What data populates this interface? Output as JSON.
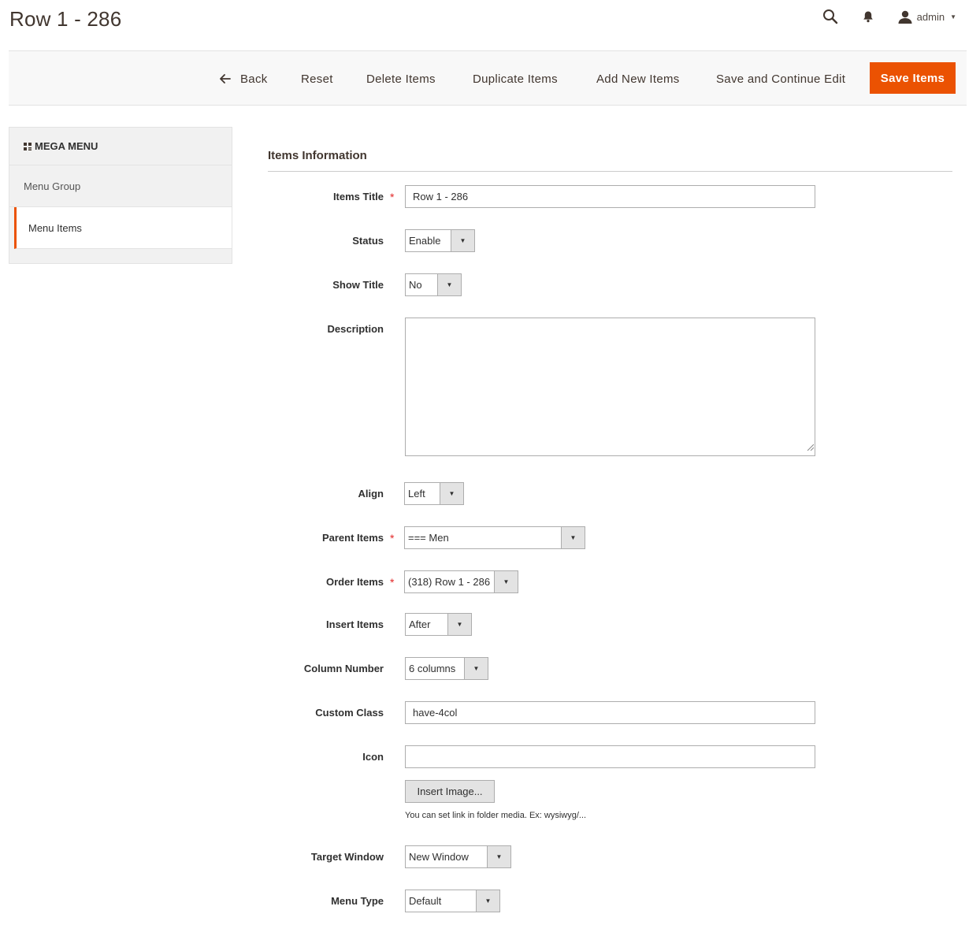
{
  "header": {
    "title": "Row 1 - 286",
    "user_name": "admin"
  },
  "toolbar": {
    "back": "Back",
    "reset": "Reset",
    "delete": "Delete Items",
    "duplicate": "Duplicate Items",
    "add_new": "Add New Items",
    "save_continue": "Save and Continue Edit",
    "save": "Save Items"
  },
  "sidebar": {
    "heading": "MEGA MENU",
    "items": [
      {
        "label": "Menu Group",
        "active": false
      },
      {
        "label": "Menu Items",
        "active": true
      }
    ]
  },
  "form": {
    "section_title": "Items Information",
    "items_title": {
      "label": "Items Title",
      "value": "Row 1 - 286",
      "required": true
    },
    "status": {
      "label": "Status",
      "value": "Enable"
    },
    "show_title": {
      "label": "Show Title",
      "value": "No"
    },
    "description": {
      "label": "Description",
      "value": ""
    },
    "align": {
      "label": "Align",
      "value": "Left"
    },
    "parent_items": {
      "label": "Parent Items",
      "value": "=== Men",
      "required": true
    },
    "order_items": {
      "label": "Order Items",
      "value": "(318) Row 1 - 286",
      "required": true
    },
    "insert_items": {
      "label": "Insert Items",
      "value": "After"
    },
    "column_number": {
      "label": "Column Number",
      "value": "6 columns"
    },
    "custom_class": {
      "label": "Custom Class",
      "value": "have-4col"
    },
    "icon": {
      "label": "Icon",
      "value": "",
      "button": "Insert Image...",
      "note": "You can set link in folder media. Ex: wysiwyg/..."
    },
    "target_window": {
      "label": "Target Window",
      "value": "New Window"
    },
    "menu_type": {
      "label": "Menu Type",
      "value": "Default"
    }
  },
  "colors": {
    "accent": "#eb5202",
    "required": "#e22626"
  },
  "icons": {
    "search": "search-icon",
    "notifications": "bell-icon",
    "user": "user-icon",
    "back": "arrow-left-icon",
    "mega_menu": "mega-menu-icon"
  }
}
